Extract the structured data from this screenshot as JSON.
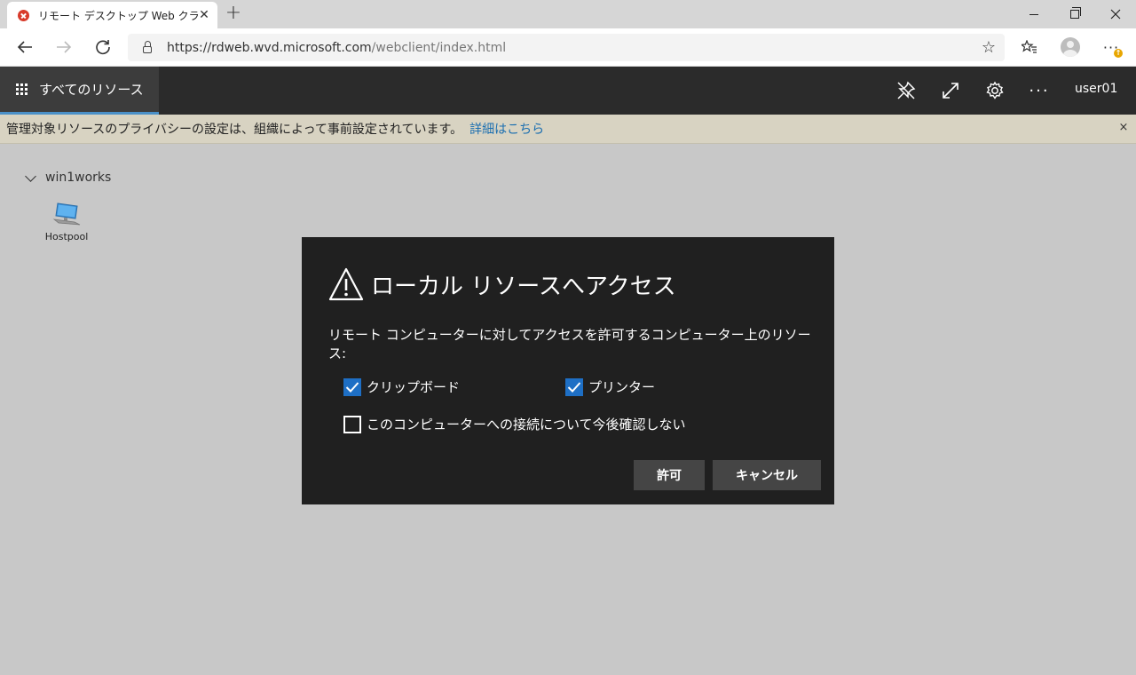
{
  "browser": {
    "tab_title": "リモート デスクトップ Web クライアント",
    "tab_close": "✕",
    "new_tab": "+",
    "url_host": "https://rdweb.wvd.microsoft.com",
    "url_path": "/webclient/index.html"
  },
  "app_header": {
    "all_resources": "すべてのリソース",
    "user": "user01"
  },
  "notice": {
    "text": "管理対象リソースのプライバシーの設定は、組織によって事前設定されています。",
    "link": "詳細はこちら",
    "close": "×"
  },
  "workspace": {
    "name": "win1works",
    "resources": [
      {
        "label": "Hostpool",
        "icon": "desktop-computer-icon"
      }
    ]
  },
  "dialog": {
    "title": "ローカル リソースへアクセス",
    "description": "リモート コンピューターに対してアクセスを許可するコンピューター上のリソース:",
    "options": [
      {
        "label": "クリップボード",
        "checked": true
      },
      {
        "label": "プリンター",
        "checked": true
      },
      {
        "label": "このコンピューターへの接続について今後確認しない",
        "checked": false
      }
    ],
    "allow_label": "許可",
    "cancel_label": "キャンセル"
  },
  "colors": {
    "header_bg": "#2b2b2b",
    "accent": "#1e6fc5",
    "dialog_bg": "#202020",
    "notice_bg": "#d8d3c2",
    "link": "#1a6eb0"
  }
}
